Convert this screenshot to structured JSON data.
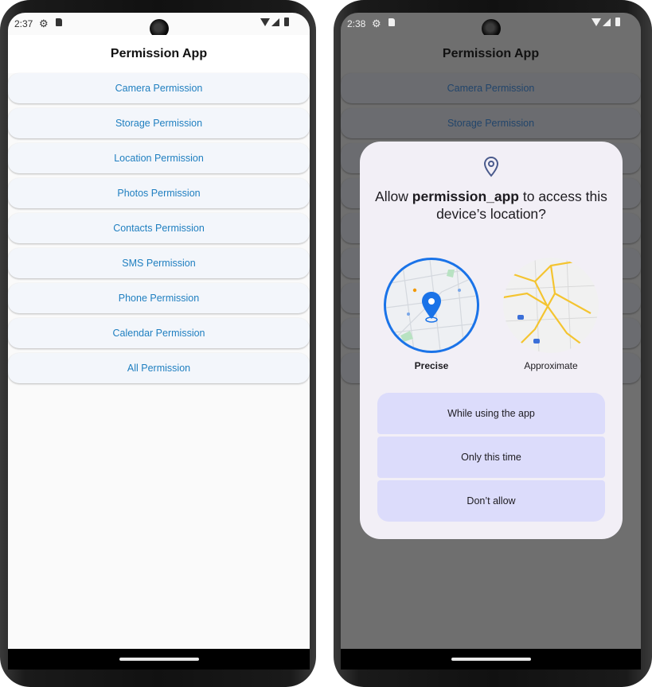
{
  "left": {
    "status": {
      "time": "2:37"
    },
    "app_title": "Permission App",
    "buttons": [
      "Camera Permission",
      "Storage Permission",
      "Location Permission",
      "Photos Permission",
      "Contacts Permission",
      "SMS Permission",
      "Phone Permission",
      "Calendar Permission",
      "All Permission"
    ]
  },
  "right": {
    "status": {
      "time": "2:38"
    },
    "app_title": "Permission App",
    "buttons": [
      "Camera Permission",
      "Storage Permission"
    ],
    "dialog": {
      "title_prefix": "Allow ",
      "app_name": "permission_app",
      "title_suffix": " to access this device’s location?",
      "precise_label": "Precise",
      "approximate_label": "Approximate",
      "choices": [
        "While using the app",
        "Only this time",
        "Don’t allow"
      ]
    }
  },
  "colors": {
    "button_text": "#1f7fc0",
    "button_bg": "#f3f6fb",
    "dialog_bg": "#f2eff6",
    "choice_bg": "#dcdcfb",
    "accent_blue": "#1a73e8"
  }
}
